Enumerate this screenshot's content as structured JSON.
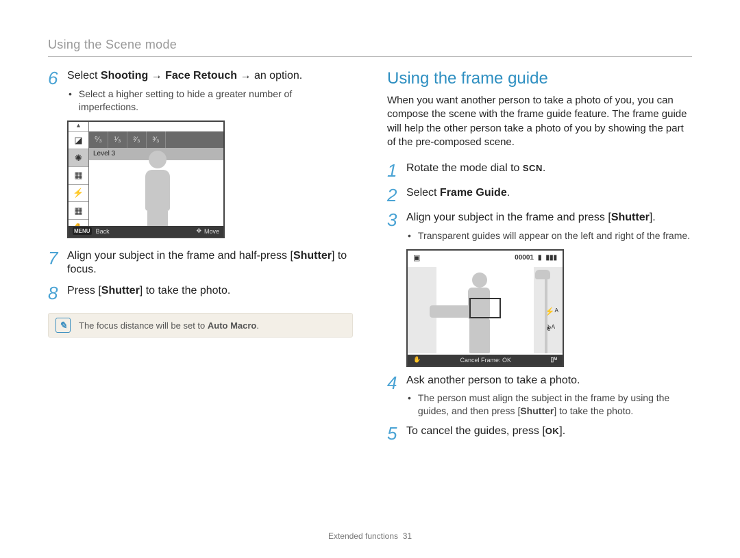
{
  "header": {
    "section": "Using the Scene mode"
  },
  "left": {
    "step6": {
      "num": "6",
      "prefix": "Select ",
      "shooting": "Shooting",
      "arrow1": " → ",
      "face": "Face Retouch",
      "arrow2": " → ",
      "suffix": "an option.",
      "bullet": "Select a higher setting to hide a greater number of imperfections."
    },
    "lcd": {
      "level_label": "Level 3",
      "back": "Back",
      "move": "Move",
      "menu": "MENU",
      "levels": [
        "⁰⁄₃",
        "¹⁄₃",
        "²⁄₃",
        "³⁄₃"
      ]
    },
    "step7": {
      "num": "7",
      "t1": "Align your subject in the frame and half-press [",
      "shutter": "Shutter",
      "t2": "] to focus."
    },
    "step8": {
      "num": "8",
      "t1": "Press [",
      "shutter": "Shutter",
      "t2": "] to take the photo."
    },
    "note": {
      "t1": "The focus distance will be set to ",
      "auto_macro": "Auto Macro",
      "t2": "."
    }
  },
  "right": {
    "title": "Using the frame guide",
    "intro": "When you want another person to take a photo of you, you can compose the scene with the frame guide feature. The frame guide will help the other person take a photo of you by showing the part of the pre-composed scene.",
    "step1": {
      "num": "1",
      "t1": "Rotate the mode dial to ",
      "scn": "SCN",
      "t2": "."
    },
    "step2": {
      "num": "2",
      "t1": "Select ",
      "fg": "Frame Guide",
      "t2": "."
    },
    "step3": {
      "num": "3",
      "t1": "Align your subject in the frame and press [",
      "shutter": "Shutter",
      "t2": "].",
      "bullet": "Transparent guides will appear on the left and right of the frame."
    },
    "lcd": {
      "counter": "00001",
      "cancel": "Cancel Frame: OK"
    },
    "step4": {
      "num": "4",
      "text": "Ask another person to take a photo.",
      "bullet_t1": "The person must align the subject in the frame by using the guides, and then press [",
      "bullet_shutter": "Shutter",
      "bullet_t2": "] to take the photo."
    },
    "step5": {
      "num": "5",
      "t1": "To cancel the guides, press [",
      "ok": "OK",
      "t2": "]."
    }
  },
  "footer": {
    "section": "Extended functions",
    "page": "31"
  }
}
